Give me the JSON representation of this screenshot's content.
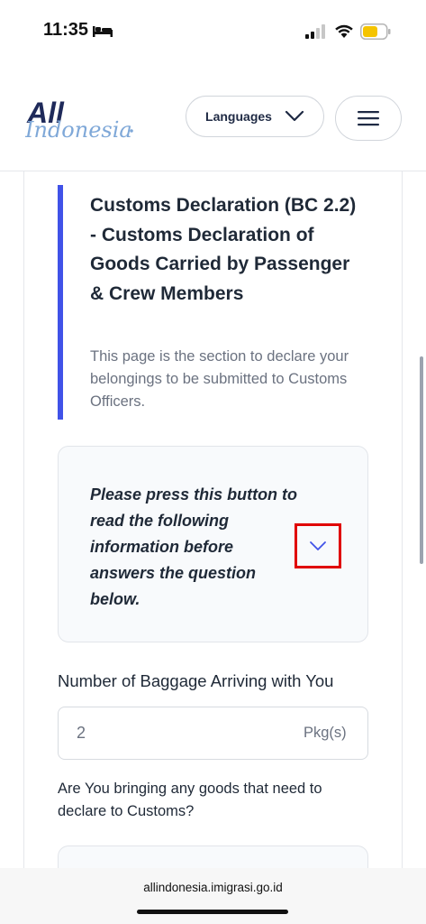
{
  "status_bar": {
    "time": "11:35"
  },
  "header": {
    "logo_text": "All Indonesia",
    "languages_label": "Languages"
  },
  "section": {
    "title": "Customs Declaration (BC 2.2) - Customs Declaration of Goods Carried by Passenger & Crew Members",
    "description": "This page is the section to declare your belongings to be submitted to Customs Officers."
  },
  "info_box": {
    "text": "Please press this button to read the following information before answers the question below."
  },
  "baggage": {
    "label": "Number of Baggage Arriving with You",
    "value": "2",
    "unit": "Pkg(s)"
  },
  "goods": {
    "question": "Are You bringing any goods that need to declare to Customs?"
  },
  "browser": {
    "url": "allindonesia.imigrasi.go.id"
  },
  "colors": {
    "accent": "#4052e8",
    "highlight": "#e00000",
    "logo_navy": "#1f2a5a",
    "logo_blue": "#7fa8d8"
  },
  "icons": [
    "bed-icon",
    "signal-icon",
    "wifi-icon",
    "battery-icon",
    "chevron-down-icon",
    "hamburger-menu-icon"
  ]
}
